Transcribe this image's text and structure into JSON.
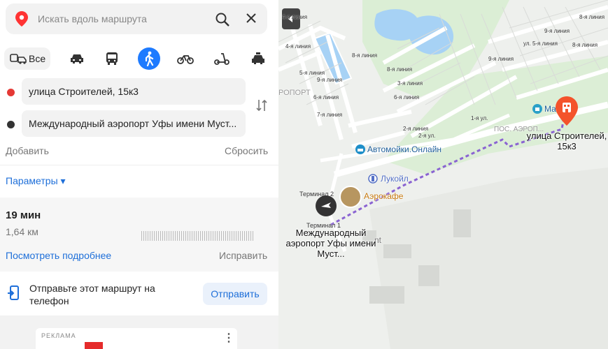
{
  "search": {
    "placeholder": "Искать вдоль маршрута"
  },
  "modes": {
    "all_label": "Все",
    "items": [
      "car-icon",
      "bus-icon",
      "walk-icon",
      "bike-icon",
      "scooter-icon",
      "taxi-icon"
    ],
    "active": "walk-icon"
  },
  "route": {
    "from": "улица Строителей, 15к3",
    "to": "Международный аэропорт Уфы имени Муст...",
    "add_label": "Добавить",
    "reset_label": "Сбросить",
    "params_label": "Параметры ▾"
  },
  "summary": {
    "duration": "19 мин",
    "distance": "1,64 км",
    "details_link": "Посмотреть подробнее",
    "fix_link": "Исправить"
  },
  "send": {
    "text": "Отправьте этот маршрут на телефон",
    "button": "Отправить"
  },
  "ad": {
    "label": "РЕКЛАМА"
  },
  "map": {
    "street_labels": [
      "4-я линия",
      "5-я линия",
      "6-я линия",
      "8-я линия",
      "9-я линия",
      "7-я линия",
      "8-я линия",
      "3-я линия",
      "2-я линия",
      "6-я линия",
      "ул. 5-я линия",
      "9-я линия",
      "8-я линия",
      "1-я ул.",
      "2-я ул.",
      "9-я линия",
      "8-я линия",
      "4-я линия"
    ],
    "area_label": "ПОС. АЭРОП...",
    "area_left": "РОПОРТ",
    "terminal2": "Терминал 2",
    "terminal1": "Терминал 1",
    "poi": {
      "carwash": "Автомойки.Онлайн",
      "lukoil": "Лукойл",
      "cafe": "Аэрокафе",
      "shop": "Ма",
      "partial": "nt"
    },
    "dest_label": "улица Строителей, 15к3",
    "origin_label": "Международный аэропорт Уфы имени Муст..."
  },
  "colors": {
    "accent": "#1e7bff",
    "route": "#8a63d2",
    "from_dot": "#e53935",
    "to_dot": "#333333",
    "pin": "#f4532b"
  }
}
